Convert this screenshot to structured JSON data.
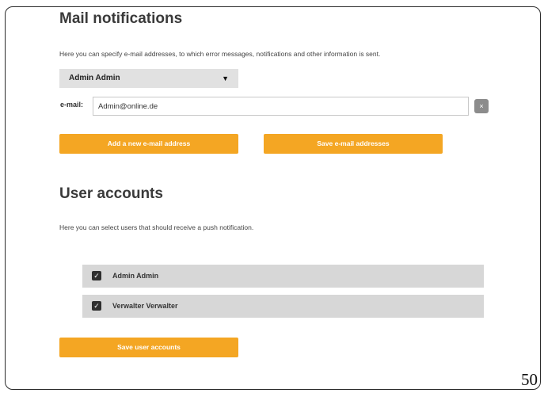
{
  "mail": {
    "title": "Mail notifications",
    "description": "Here you can specify e-mail addresses, to which error messages, notifications and other information is sent.",
    "selected_user": "Admin Admin",
    "email_label": "e-mail:",
    "email_value": "Admin@online.de",
    "remove_symbol": "×",
    "add_button": "Add a new e-mail address",
    "save_button": "Save e-mail addresses"
  },
  "accounts": {
    "title": "User accounts",
    "description": "Here you can select users that should receive a push notification.",
    "users": [
      {
        "name": "Admin Admin",
        "checked": true
      },
      {
        "name": "Verwalter Verwalter",
        "checked": true
      }
    ],
    "save_button": "Save user accounts"
  },
  "page_number": "50",
  "colors": {
    "accent": "#f4a623",
    "row_bg": "#d7d7d7",
    "select_bg": "#e1e1e1"
  },
  "icons": {
    "dropdown": "caret-down-icon",
    "remove": "close-icon",
    "checkbox": "checkbox-checked-icon"
  }
}
